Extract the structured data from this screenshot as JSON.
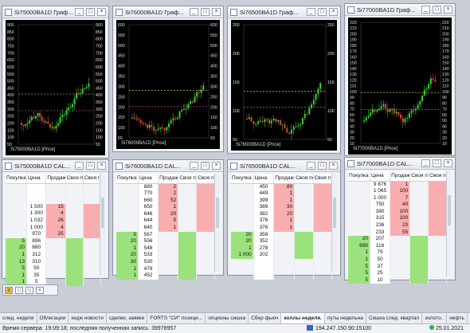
{
  "charts": [
    {
      "title": "Si75000BA1D Граф...",
      "legend": "Si75000BA1D [Price]",
      "left_ticks": [
        "900",
        "850",
        "800",
        "750",
        "700",
        "650",
        "600",
        "550",
        "500",
        "450",
        "400",
        "350",
        "300",
        "250",
        "200",
        "150",
        "100",
        "50"
      ],
      "right_ticks": [
        "900",
        "850",
        "800",
        "750",
        "700",
        "650",
        "600",
        "550",
        "500",
        "450",
        "400",
        "350",
        "300",
        "250",
        "200",
        "150",
        "100",
        "50"
      ]
    },
    {
      "title": "Si76000BA1D Граф...",
      "legend": "Si76000BA1D [Price]",
      "left_ticks": [
        "600",
        "550",
        "500",
        "450",
        "400",
        "350",
        "300",
        "250",
        "200",
        "150",
        "100",
        "50"
      ],
      "right_ticks": [
        "600",
        "550",
        "500",
        "450",
        "400",
        "350",
        "300",
        "250",
        "200",
        "150",
        "100",
        "50"
      ]
    },
    {
      "title": "Si76500BA1D Граф...",
      "legend": "Si76500BA1D [Price]",
      "left_ticks": [
        "250",
        "200",
        "150",
        "100",
        "50"
      ],
      "right_ticks": [
        "250",
        "200",
        "150",
        "100",
        "50"
      ]
    },
    {
      "title": "Si77000BA1D Граф...",
      "legend": "Si77000BA1D [Price]",
      "left_ticks": [
        "220",
        "210",
        "200",
        "190",
        "180",
        "170",
        "160",
        "150",
        "140",
        "130",
        "120",
        "110",
        "100",
        "90",
        "80",
        "70",
        "60",
        "50",
        "40",
        "30",
        "20",
        "10"
      ],
      "right_ticks": [
        "220",
        "210",
        "200",
        "190",
        "180",
        "170",
        "160",
        "150",
        "140",
        "130",
        "120",
        "110",
        "100",
        "90",
        "80",
        "70",
        "60",
        "50",
        "40",
        "30",
        "20",
        "10"
      ]
    }
  ],
  "glasses": [
    {
      "title": "Si75000BA1D CAL...",
      "headers": [
        "Покупка",
        "Цена",
        "Продажа",
        "Своя по",
        "Своя пр"
      ],
      "rows": [
        [
          "",
          "",
          "",
          "",
          ""
        ],
        [
          "",
          "",
          "",
          "",
          ""
        ],
        [
          "",
          "",
          "",
          "",
          ""
        ],
        [
          "",
          "1 500",
          "15",
          "",
          ""
        ],
        [
          "",
          "1 300",
          "4",
          "",
          ""
        ],
        [
          "",
          "1 032",
          "26",
          "",
          ""
        ],
        [
          "",
          "1 000",
          "4",
          "",
          ""
        ],
        [
          "",
          "970",
          "25",
          "",
          ""
        ],
        [
          "5",
          "896",
          "",
          "",
          ""
        ],
        [
          "20",
          "880",
          "",
          "",
          ""
        ],
        [
          "1",
          "312",
          "",
          "",
          ""
        ],
        [
          "13",
          "310",
          "",
          "",
          ""
        ],
        [
          "5",
          "50",
          "",
          "",
          ""
        ],
        [
          "1",
          "35",
          "",
          "",
          ""
        ],
        [
          "1",
          "5",
          "",
          "",
          ""
        ]
      ],
      "sell_rows": 5,
      "sell_start": 3
    },
    {
      "title": "Si76000BA1D CAL...",
      "headers": [
        "Покупка",
        "Цена",
        "Продажа",
        "Своя по",
        "Своя п"
      ],
      "rows": [
        [
          "",
          "880",
          "2",
          "",
          ""
        ],
        [
          "",
          "770",
          "2",
          "",
          ""
        ],
        [
          "",
          "660",
          "52",
          "",
          ""
        ],
        [
          "",
          "650",
          "1",
          "",
          ""
        ],
        [
          "",
          "646",
          "20",
          "",
          ""
        ],
        [
          "",
          "644",
          "5",
          "",
          ""
        ],
        [
          "",
          "640",
          "1",
          "",
          ""
        ],
        [
          "5",
          "567",
          "",
          "",
          ""
        ],
        [
          "20",
          "556",
          "",
          "",
          ""
        ],
        [
          "1",
          "548",
          "",
          "",
          ""
        ],
        [
          "20",
          "533",
          "",
          "",
          ""
        ],
        [
          "30",
          "530",
          "",
          "",
          ""
        ],
        [
          "1",
          "478",
          "",
          "",
          ""
        ],
        [
          "1",
          "452",
          "",
          "",
          ""
        ]
      ],
      "sell_rows": 7,
      "sell_start": 0
    },
    {
      "title": "Si76500BA1D CAL...",
      "headers": [
        "Покупка",
        "Цена",
        "Продажа",
        "Своя по",
        "Своя п"
      ],
      "rows": [
        [
          "",
          "450",
          "80",
          "",
          ""
        ],
        [
          "",
          "449",
          "1",
          "",
          ""
        ],
        [
          "",
          "399",
          "1",
          "",
          ""
        ],
        [
          "",
          "389",
          "30",
          "",
          ""
        ],
        [
          "",
          "382",
          "20",
          "",
          ""
        ],
        [
          "",
          "378",
          "1",
          "",
          ""
        ],
        [
          "",
          "376",
          "1",
          "",
          ""
        ],
        [
          "20",
          "358",
          "",
          "",
          ""
        ],
        [
          "20",
          "352",
          "",
          "",
          ""
        ],
        [
          "1",
          "278",
          "",
          "",
          ""
        ],
        [
          "1 000",
          "202",
          "",
          "",
          ""
        ],
        [
          "",
          "",
          "",
          "",
          ""
        ],
        [
          "",
          "",
          "",
          "",
          ""
        ],
        [
          "",
          "",
          "",
          "",
          ""
        ]
      ],
      "sell_rows": 7,
      "sell_start": 0,
      "buy_rows": 4
    },
    {
      "title": "Si77000BA1D CAL...",
      "headers": [
        "Покупка",
        "Цена",
        "Продажа",
        "Своя по",
        "Своя п"
      ],
      "rows": [
        [
          "",
          "9 876",
          "1",
          "",
          ""
        ],
        [
          "",
          "1 065",
          "100",
          "",
          ""
        ],
        [
          "",
          "1 000",
          "7",
          "",
          ""
        ],
        [
          "",
          "750",
          "40",
          "",
          ""
        ],
        [
          "",
          "380",
          "100",
          "",
          ""
        ],
        [
          "",
          "315",
          "100",
          "",
          ""
        ],
        [
          "",
          "236",
          "20",
          "",
          ""
        ],
        [
          "",
          "233",
          "55",
          "",
          ""
        ],
        [
          "20",
          "207",
          "",
          "",
          ""
        ],
        [
          "999",
          "116",
          "",
          "",
          ""
        ],
        [
          "1",
          "79",
          "",
          "",
          ""
        ],
        [
          "1",
          "50",
          "",
          "",
          ""
        ],
        [
          "5",
          "37",
          "",
          "",
          ""
        ],
        [
          "5",
          "25",
          "",
          "",
          ""
        ],
        [
          "5",
          "10",
          "",
          "",
          ""
        ]
      ],
      "sell_rows": 8,
      "sell_start": 0
    }
  ],
  "tabs": [
    "след. неделя",
    "Облигации",
    "хедж новости",
    "сделки, заявки",
    "FORTS \"СИ\" позици...",
    "опционы сишка",
    "Сбер фьюч",
    "коллы неделя.",
    "путы недельна",
    "Сишка след. квартал",
    "золото..",
    "нефть",
    "опционы ртс"
  ],
  "active_tab": 7,
  "status": {
    "left": "Время сервера: 19:09:18; последняя полученная запись: 39978957",
    "ip": "194.247.150.90:15100",
    "date": "25.01.2021"
  }
}
